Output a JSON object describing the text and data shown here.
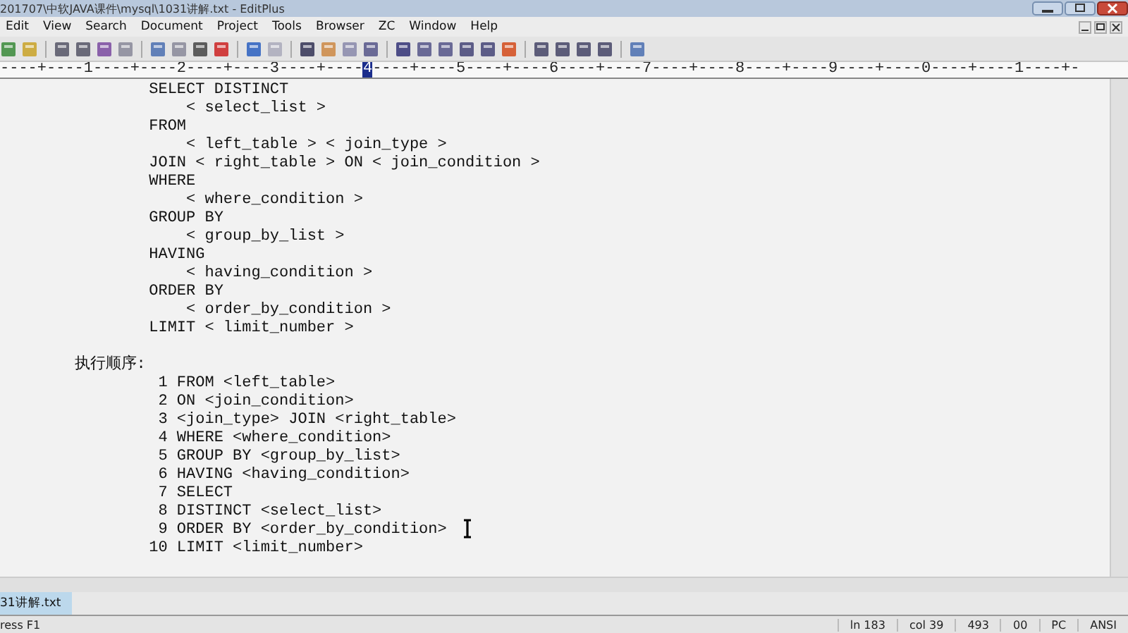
{
  "window": {
    "title": "201707\\中软JAVA课件\\mysql\\1031讲解.txt - EditPlus"
  },
  "menu": [
    "Edit",
    "View",
    "Search",
    "Document",
    "Project",
    "Tools",
    "Browser",
    "ZC",
    "Window",
    "Help"
  ],
  "ruler": {
    "before": "----+----1----+----2----+----3----+----",
    "cursor": "4",
    "after": "----+----5----+----6----+----7----+----8----+----9----+----0----+----1----+-"
  },
  "query_lines": [
    "                SELECT DISTINCT",
    "                    < select_list >",
    "                FROM",
    "                    < left_table > < join_type >",
    "                JOIN < right_table > ON < join_condition >",
    "                WHERE",
    "                    < where_condition >",
    "                GROUP BY",
    "                    < group_by_list >",
    "                HAVING",
    "                    < having_condition >",
    "                ORDER BY",
    "                    < order_by_condition >",
    "                LIMIT < limit_number >"
  ],
  "order_heading": "        执行顺序:",
  "order_lines": [
    "                 1 FROM <left_table>",
    "                 2 ON <join_condition>",
    "                 3 <join_type> JOIN <right_table>",
    "                 4 WHERE <where_condition>",
    "                 5 GROUP BY <group_by_list>",
    "                 6 HAVING <having_condition>",
    "                 7 SELECT",
    "                 8 DISTINCT <select_list>",
    "                 9 ORDER BY <order_by_condition>",
    "                10 LIMIT <limit_number>"
  ],
  "tabs": [
    {
      "label": "31讲解.txt",
      "selected": true
    }
  ],
  "status_bar": {
    "hint": "ress F1",
    "fields": [
      "ln 183",
      "col 39",
      "493",
      "00",
      "PC",
      "ANSI"
    ]
  }
}
